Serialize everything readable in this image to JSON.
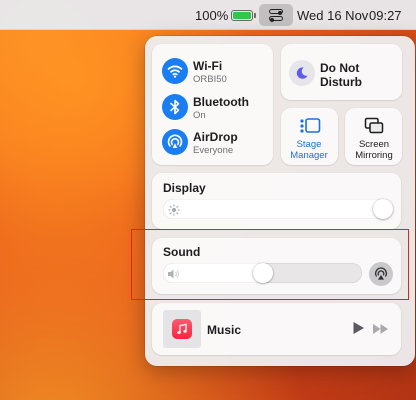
{
  "menubar": {
    "battery_percent": "100%",
    "battery_level": 1.0,
    "date": "Wed 16 Nov",
    "time": "09:27",
    "icons": [
      "battery-icon",
      "control-centre-icon"
    ]
  },
  "control_centre": {
    "connectivity": [
      {
        "title": "Wi-Fi",
        "subtitle": "ORBI50",
        "icon": "wifi-icon"
      },
      {
        "title": "Bluetooth",
        "subtitle": "On",
        "icon": "bluetooth-icon"
      },
      {
        "title": "AirDrop",
        "subtitle": "Everyone",
        "icon": "airdrop-icon"
      }
    ],
    "do_not_disturb": {
      "label": "Do Not Disturb",
      "icon": "moon-icon"
    },
    "stage_manager": {
      "label": "Stage Manager",
      "icon": "stage-manager-icon",
      "active": true
    },
    "screen_mirroring": {
      "label": "Screen Mirroring",
      "icon": "screen-mirroring-icon"
    },
    "display": {
      "title": "Display",
      "brightness": 1.0,
      "icon": "sun-icon"
    },
    "sound": {
      "title": "Sound",
      "volume": 0.5,
      "icons": [
        "speaker-icon",
        "airplay-audio-icon"
      ]
    },
    "music": {
      "title": "Music",
      "icons": [
        "music-app-icon",
        "play-icon",
        "next-track-icon"
      ]
    }
  },
  "colors": {
    "accent": "#1a7df2",
    "highlight_box": "#e3241d",
    "battery_fill": "#32c54b",
    "music_red": "#fa233b"
  }
}
